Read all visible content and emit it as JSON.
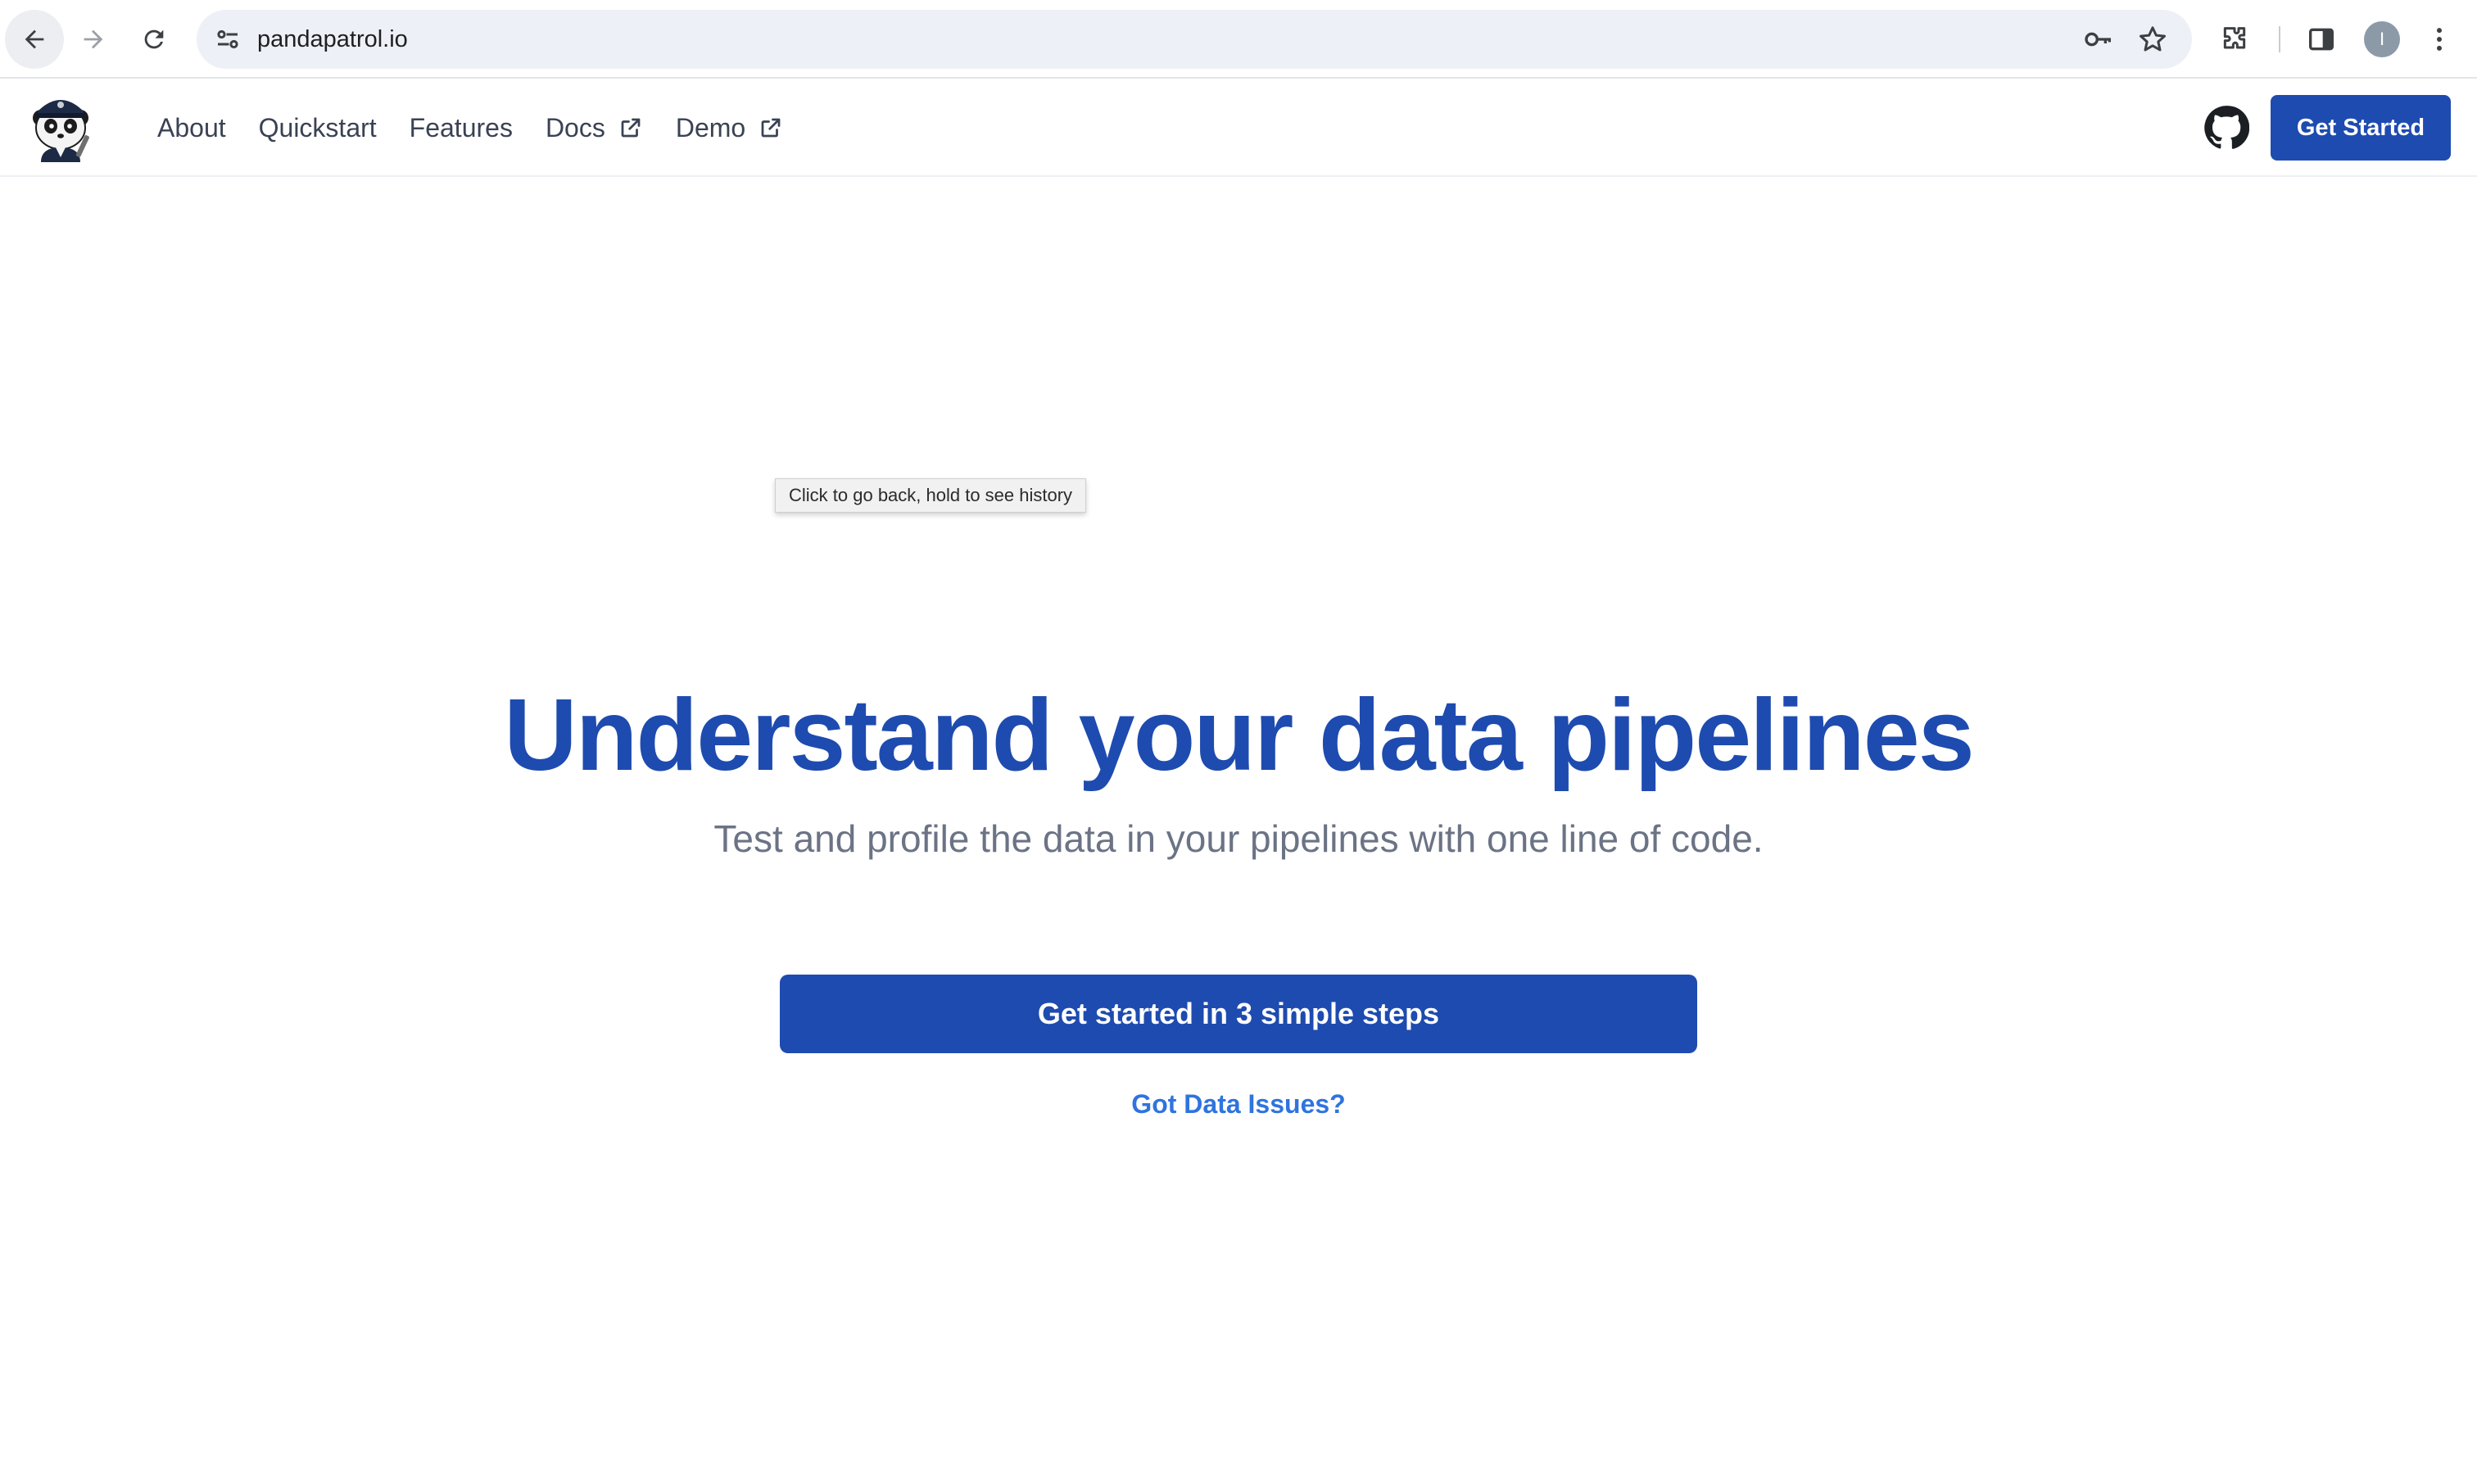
{
  "browser": {
    "url": "pandapatrol.io",
    "icons": {
      "back": "arrow-left-icon",
      "forward": "arrow-right-icon",
      "reload": "reload-icon",
      "site_info": "tune-icon",
      "password": "key-icon",
      "bookmark": "star-icon",
      "extensions": "puzzle-icon",
      "side_panel": "side-panel-icon",
      "menu": "kebab-menu-icon"
    },
    "profile_initial": "I",
    "tooltip": "Click to go back, hold to see history"
  },
  "header": {
    "nav": [
      {
        "label": "About",
        "external": false
      },
      {
        "label": "Quickstart",
        "external": false
      },
      {
        "label": "Features",
        "external": false
      },
      {
        "label": "Docs",
        "external": true
      },
      {
        "label": "Demo",
        "external": true
      }
    ],
    "cta_label": "Get Started"
  },
  "hero": {
    "title": "Understand your data pipelines",
    "subtitle": "Test and profile the data in your pipelines with one line of code.",
    "cta_label": "Get started in 3 simple steps",
    "link_label": "Got Data Issues?"
  },
  "colors": {
    "brand": "#1e4baf",
    "link": "#2f74df",
    "subtitle": "#6b7385",
    "nav_text": "#3a4254"
  }
}
